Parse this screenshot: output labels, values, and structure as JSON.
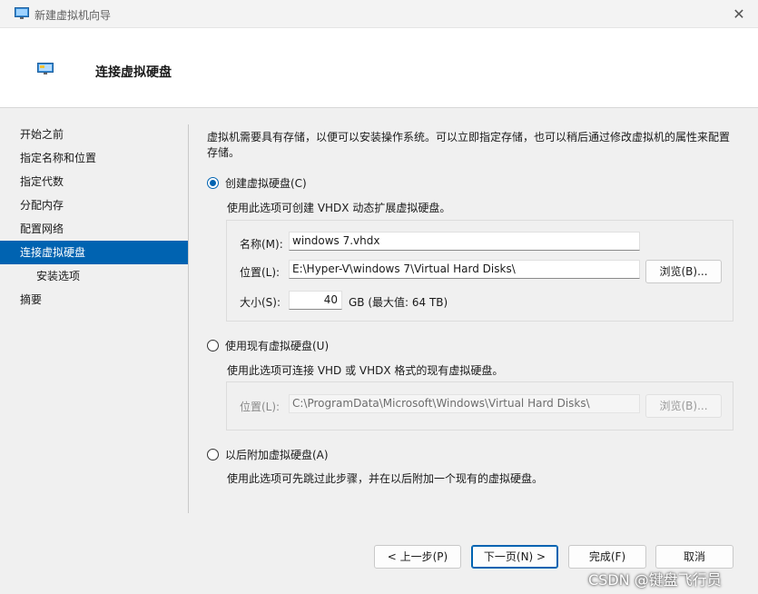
{
  "window": {
    "title": "新建虚拟机向导",
    "close_glyph": "✕"
  },
  "header": {
    "title": "连接虚拟硬盘"
  },
  "nav": {
    "items": [
      {
        "label": "开始之前"
      },
      {
        "label": "指定名称和位置"
      },
      {
        "label": "指定代数"
      },
      {
        "label": "分配内存"
      },
      {
        "label": "配置网络"
      },
      {
        "label": "连接虚拟硬盘"
      },
      {
        "label": "安装选项"
      },
      {
        "label": "摘要"
      }
    ]
  },
  "intro": "虚拟机需要具有存储，以便可以安装操作系统。可以立即指定存储，也可以稍后通过修改虚拟机的属性来配置存储。",
  "option_create": {
    "label": "创建虚拟硬盘(C)",
    "desc": "使用此选项可创建 VHDX 动态扩展虚拟硬盘。",
    "name_label": "名称(M):",
    "name_value": "windows 7.vhdx",
    "location_label": "位置(L):",
    "location_value": "E:\\Hyper-V\\windows 7\\Virtual Hard Disks\\",
    "browse_label": "浏览(B)...",
    "size_label": "大小(S):",
    "size_value": "40",
    "size_unit": "GB (最大值: 64 TB)"
  },
  "option_existing": {
    "label": "使用现有虚拟硬盘(U)",
    "desc": "使用此选项可连接 VHD 或 VHDX 格式的现有虚拟硬盘。",
    "location_label": "位置(L):",
    "location_value": "C:\\ProgramData\\Microsoft\\Windows\\Virtual Hard Disks\\",
    "browse_label": "浏览(B)..."
  },
  "option_later": {
    "label": "以后附加虚拟硬盘(A)",
    "desc": "使用此选项可先跳过此步骤，并在以后附加一个现有的虚拟硬盘。"
  },
  "footer": {
    "prev": "< 上一步(P)",
    "next": "下一页(N) >",
    "finish": "完成(F)",
    "cancel": "取消"
  },
  "watermark": "CSDN @键盘飞行员",
  "colors": {
    "accent": "#0063b1",
    "header_bg": "#ffffff",
    "body_bg": "#f0f0f0"
  },
  "icons": {
    "app": "monitor-icon",
    "header": "monitor-icon"
  }
}
